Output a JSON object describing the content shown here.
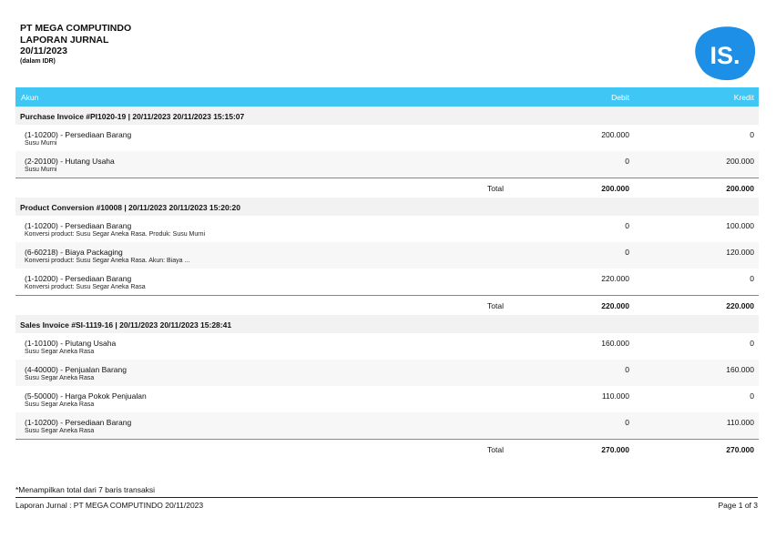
{
  "header": {
    "company": "PT MEGA COMPUTINDO",
    "report": "LAPORAN JURNAL",
    "date": "20/11/2023",
    "currency_note": "(dalam IDR)"
  },
  "logo": {
    "text": "IS.",
    "color": "#1e8fe6"
  },
  "columns": {
    "account": "Akun",
    "debit": "Debit",
    "credit": "Kredit"
  },
  "colors": {
    "header_bg": "#3fc6f4"
  },
  "groups": [
    {
      "title": "Purchase Invoice #PI1020-19 | 20/11/2023  20/11/2023 15:15:07",
      "rows": [
        {
          "account": "(1-10200) - Persediaan Barang",
          "desc": "Susu Murni",
          "debit": "200.000",
          "credit": "0"
        },
        {
          "account": "(2-20100) - Hutang Usaha",
          "desc": "Susu Murni",
          "debit": "0",
          "credit": "200.000"
        }
      ],
      "total": {
        "label": "Total",
        "debit": "200.000",
        "credit": "200.000"
      }
    },
    {
      "title": "Product Conversion #10008 | 20/11/2023  20/11/2023 15:20:20",
      "rows": [
        {
          "account": "(1-10200) - Persediaan Barang",
          "desc": "Konversi product: Susu Segar Aneka Rasa. Produk: Susu Murni",
          "debit": "0",
          "credit": "100.000"
        },
        {
          "account": "(6-60218) - Biaya Packaging",
          "desc": "Konversi product: Susu Segar Aneka Rasa. Akun: Biaya ...",
          "debit": "0",
          "credit": "120.000"
        },
        {
          "account": "(1-10200) - Persediaan Barang",
          "desc": "Konversi product: Susu Segar Aneka Rasa",
          "debit": "220.000",
          "credit": "0"
        }
      ],
      "total": {
        "label": "Total",
        "debit": "220.000",
        "credit": "220.000"
      }
    },
    {
      "title": "Sales Invoice #SI-1119-16 | 20/11/2023  20/11/2023 15:28:41",
      "rows": [
        {
          "account": "(1-10100) - Piutang Usaha",
          "desc": "Susu Segar Aneka Rasa",
          "debit": "160.000",
          "credit": "0"
        },
        {
          "account": "(4-40000) - Penjualan Barang",
          "desc": "Susu Segar Aneka Rasa",
          "debit": "0",
          "credit": "160.000"
        },
        {
          "account": "(5-50000) - Harga Pokok Penjualan",
          "desc": "Susu Segar Aneka Rasa",
          "debit": "110.000",
          "credit": "0"
        },
        {
          "account": "(1-10200) - Persediaan Barang",
          "desc": "Susu Segar Aneka Rasa",
          "debit": "0",
          "credit": "110.000"
        }
      ],
      "total": {
        "label": "Total",
        "debit": "270.000",
        "credit": "270.000"
      }
    }
  ],
  "note": "*Menampilkan total dari 7 baris transaksi",
  "footer": {
    "left": "Laporan Jurnal : PT MEGA COMPUTINDO 20/11/2023",
    "right": "Page 1 of 3"
  }
}
